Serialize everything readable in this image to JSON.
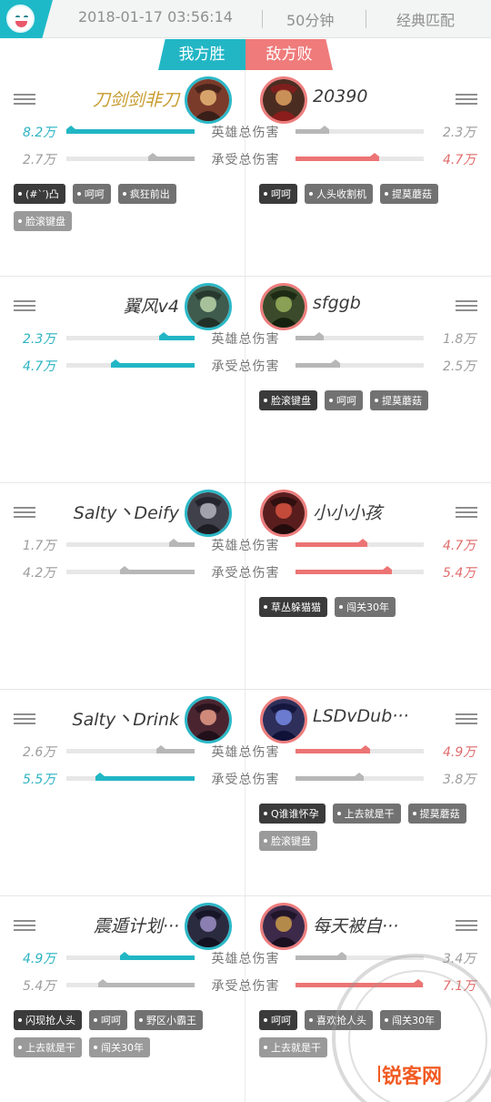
{
  "header": {
    "date": "2018-01-17 03:56:14",
    "duration": "50分钟",
    "mode": "经典匹配",
    "win_label": "我方胜",
    "lose_label": "敌方败"
  },
  "stats": {
    "dmg_dealt_label": "英雄总伤害",
    "dmg_taken_label": "承受总伤害"
  },
  "colors": {
    "win": "#22b6c5",
    "lose": "#ec7474",
    "neutral": "#b7b7b7"
  },
  "matchups": [
    {
      "left": {
        "name": "刀剑剑非刀",
        "dealt": "8.2万",
        "taken": "2.7万",
        "dealt_level": 1.0,
        "taken_level": 0.36,
        "tags": [
          "(#`′)凸",
          "呵呵",
          "疯狂前出",
          "脸滚键盘"
        ]
      },
      "right": {
        "name": "20390",
        "dealt": "2.3万",
        "taken": "4.7万",
        "dealt_level": 0.26,
        "taken_level": 0.65,
        "tags": [
          "呵呵",
          "人头收割机",
          "提莫蘑菇",
          ""
        ]
      }
    },
    {
      "left": {
        "name": "翼风v4",
        "dealt": "2.3万",
        "taken": "4.7万",
        "dealt_level": 0.28,
        "taken_level": 0.65,
        "tags": [
          "",
          "",
          "",
          ""
        ]
      },
      "right": {
        "name": "sfggb",
        "dealt": "1.8万",
        "taken": "2.5万",
        "dealt_level": 0.22,
        "taken_level": 0.35,
        "tags": [
          "脸滚键盘",
          "呵呵",
          "提莫蘑菇",
          ""
        ]
      }
    },
    {
      "left": {
        "name": "Salty丶Deify",
        "dealt": "1.7万",
        "taken": "4.2万",
        "dealt_level": 0.2,
        "taken_level": 0.58,
        "tags": [
          "",
          "",
          "",
          ""
        ]
      },
      "right": {
        "name": "小小小孩",
        "dealt": "4.7万",
        "taken": "5.4万",
        "dealt_level": 0.56,
        "taken_level": 0.75,
        "tags": [
          "草丛躲猫猫",
          "闯关30年",
          "",
          ""
        ]
      }
    },
    {
      "left": {
        "name": "Salty丶Drink",
        "dealt": "2.6万",
        "taken": "5.5万",
        "dealt_level": 0.3,
        "taken_level": 0.77,
        "tags": [
          "",
          "",
          "",
          ""
        ]
      },
      "right": {
        "name": "LSDvDub···",
        "dealt": "4.9万",
        "taken": "3.8万",
        "dealt_level": 0.58,
        "taken_level": 0.53,
        "tags": [
          "Q谁谁怀孕",
          "上去就是干",
          "提莫蘑菇",
          "脸滚键盘"
        ]
      }
    },
    {
      "left": {
        "name": "震遁计划···",
        "dealt": "4.9万",
        "taken": "5.4万",
        "dealt_level": 0.58,
        "taken_level": 0.75,
        "tags": [
          "闪现抢人头",
          "呵呵",
          "野区小霸王",
          "上去就是干",
          "闯关30年"
        ]
      },
      "right": {
        "name": "每天被自···",
        "dealt": "3.4万",
        "taken": "7.1万",
        "dealt_level": 0.4,
        "taken_level": 0.99,
        "tags": [
          "呵呵",
          "喜欢抢人头",
          "闯关30年",
          "上去就是干"
        ]
      }
    }
  ],
  "watermark": {
    "site": "锐客网"
  }
}
